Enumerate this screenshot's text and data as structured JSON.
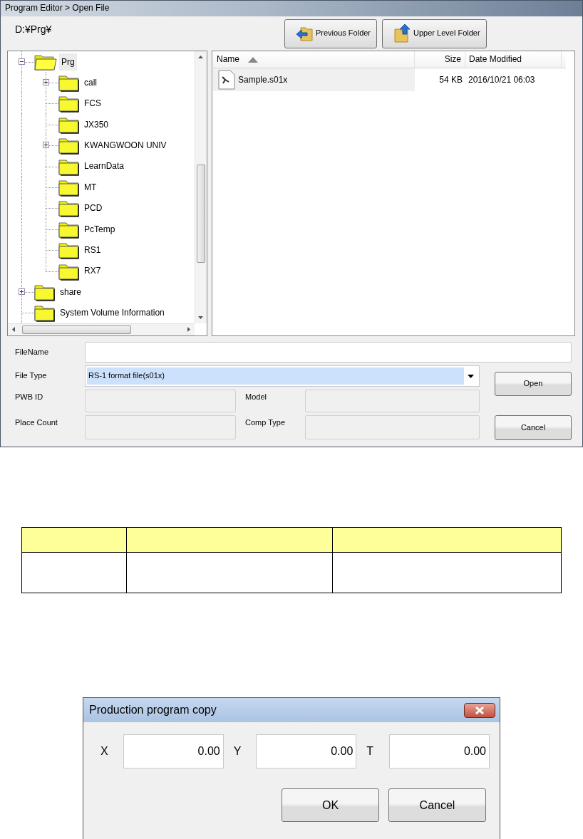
{
  "window": {
    "title": "Program Editor > Open File"
  },
  "path": "D:¥Prg¥",
  "toolbar": [
    {
      "label": "Previous Folder",
      "kind": "back"
    },
    {
      "label": "Upper Level Folder",
      "kind": "up"
    }
  ],
  "tree": [
    {
      "label": "Prg",
      "expanded": true,
      "selected": true,
      "children": [
        {
          "label": "call",
          "expanded": false,
          "selected": false
        },
        {
          "label": "FCS",
          "selected": false
        },
        {
          "label": "JX350",
          "selected": false
        },
        {
          "label": "KWANGWOON UNIV",
          "expanded": false,
          "selected": false
        },
        {
          "label": "LearnData",
          "selected": false
        },
        {
          "label": "MT",
          "selected": false
        },
        {
          "label": "PCD",
          "selected": false
        },
        {
          "label": "PcTemp",
          "selected": false
        },
        {
          "label": "RS1",
          "selected": false
        },
        {
          "label": "RX7",
          "selected": false
        }
      ]
    },
    {
      "label": "share",
      "expanded": false,
      "selected": false
    },
    {
      "label": "System Volume Information",
      "selected": false
    }
  ],
  "file_list": {
    "columns": [
      {
        "label": "Name",
        "sorted": true
      },
      {
        "label": "Size",
        "sorted": false
      },
      {
        "label": "Date Modified",
        "sorted": false
      }
    ],
    "rows": [
      {
        "name": "Sample.s01x",
        "size": "54 KB",
        "modified": "2016/10/21 06:03",
        "selected": true
      }
    ]
  },
  "form": {
    "file_name": {
      "label": "FileName"
    },
    "file_type": {
      "label": "File Type",
      "value": "RS-1 format file(s01x)",
      "highlighted": true
    },
    "info_fields": [
      {
        "label": "PWB ID",
        "disabled": true
      },
      {
        "label": "Model",
        "disabled": true
      },
      {
        "label": "Place Count",
        "disabled": true
      },
      {
        "label": "Comp Type",
        "disabled": true
      }
    ],
    "buttons": [
      "Open",
      "Cancel"
    ]
  },
  "copy_dialog": {
    "title": "Production program copy",
    "fields": [
      {
        "label": "X",
        "value": "0.00"
      },
      {
        "label": "Y",
        "value": "0.00"
      },
      {
        "label": "T",
        "value": "0.00"
      }
    ],
    "buttons": [
      "OK",
      "Cancel"
    ]
  }
}
